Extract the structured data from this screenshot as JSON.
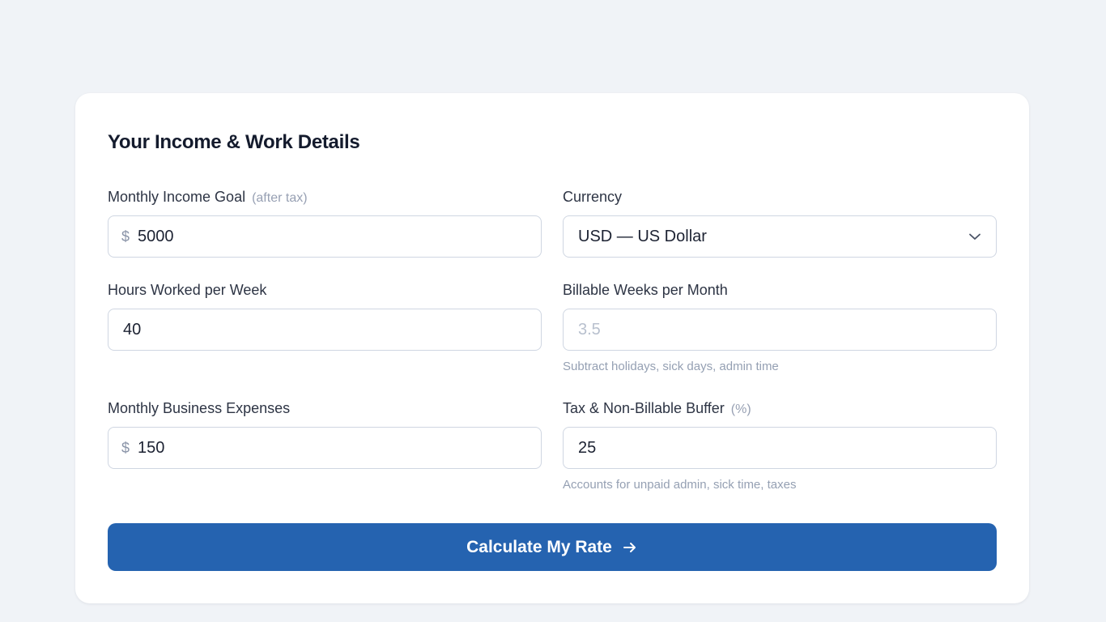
{
  "form": {
    "title": "Your Income & Work Details",
    "income_goal": {
      "label": "Monthly Income Goal",
      "sublabel": "(after tax)",
      "prefix": "$",
      "value": "5000"
    },
    "currency": {
      "label": "Currency",
      "value": "USD — US Dollar",
      "icon": "chevron-down-icon"
    },
    "hours_per_week": {
      "label": "Hours Worked per Week",
      "value": "40"
    },
    "billable_weeks": {
      "label": "Billable Weeks per Month",
      "placeholder": "3.5",
      "hint": "Subtract holidays, sick days, admin time"
    },
    "expenses": {
      "label": "Monthly Business Expenses",
      "prefix": "$",
      "value": "150"
    },
    "buffer": {
      "label": "Tax & Non-Billable Buffer",
      "sublabel": "(%)",
      "value": "25",
      "hint": "Accounts for unpaid admin, sick time, taxes"
    },
    "submit": {
      "label": "Calculate My Rate",
      "icon": "arrow-right-icon"
    }
  },
  "colors": {
    "background": "#f0f3f7",
    "card": "#ffffff",
    "accent": "#2563b0",
    "border": "#cfd6e2",
    "muted": "#95a0b3"
  }
}
